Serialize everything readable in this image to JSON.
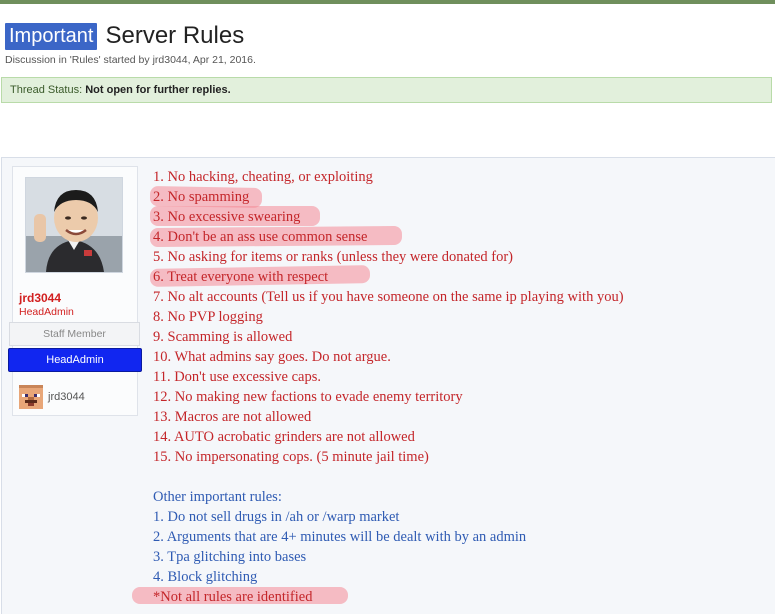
{
  "thread": {
    "prefix": "Important",
    "title": "Server Rules",
    "meta": "Discussion in 'Rules' started by jrd3044, Apr 21, 2016.",
    "status_label": "Thread Status:",
    "status_value": "Not open for further replies."
  },
  "author": {
    "username": "jrd3044",
    "user_title": "HeadAdmin",
    "staff_label": "Staff Member",
    "group_badge": "HeadAdmin",
    "mini_username": "jrd3044"
  },
  "rules": [
    "1. No hacking, cheating, or exploiting",
    "2. No spamming",
    "3. No excessive swearing",
    "4. Don't be an ass use common sense",
    "5. No asking for items or ranks (unless they were donated for)",
    "6. Treat everyone with respect",
    "7. No alt accounts (Tell us if you have someone on the same ip playing with you)",
    "8. No PVP logging",
    "9. Scamming is allowed",
    "10. What admins say goes. Do not argue.",
    "11. Don't use excessive caps.",
    "12. No making new factions to evade enemy territory",
    "13. Macros are not allowed",
    "14. AUTO acrobatic grinders are not allowed",
    "15. No impersonating cops. (5 minute jail time)"
  ],
  "other_rules": {
    "heading": "Other important rules:",
    "items": [
      "1. Do not sell drugs in /ah or /warp market",
      "2. Arguments that are 4+ minutes will be dealt with by an admin",
      "3. Tpa glitching into bases",
      "4. Block glitching"
    ],
    "footnote": "*Not all rules are identified"
  },
  "colors": {
    "rule_text": "#c4262a",
    "other_text": "#2f5bb3",
    "prefix_bg": "#3b66c7",
    "badge_bg": "#1126f0",
    "highlight": "#f48a96"
  }
}
